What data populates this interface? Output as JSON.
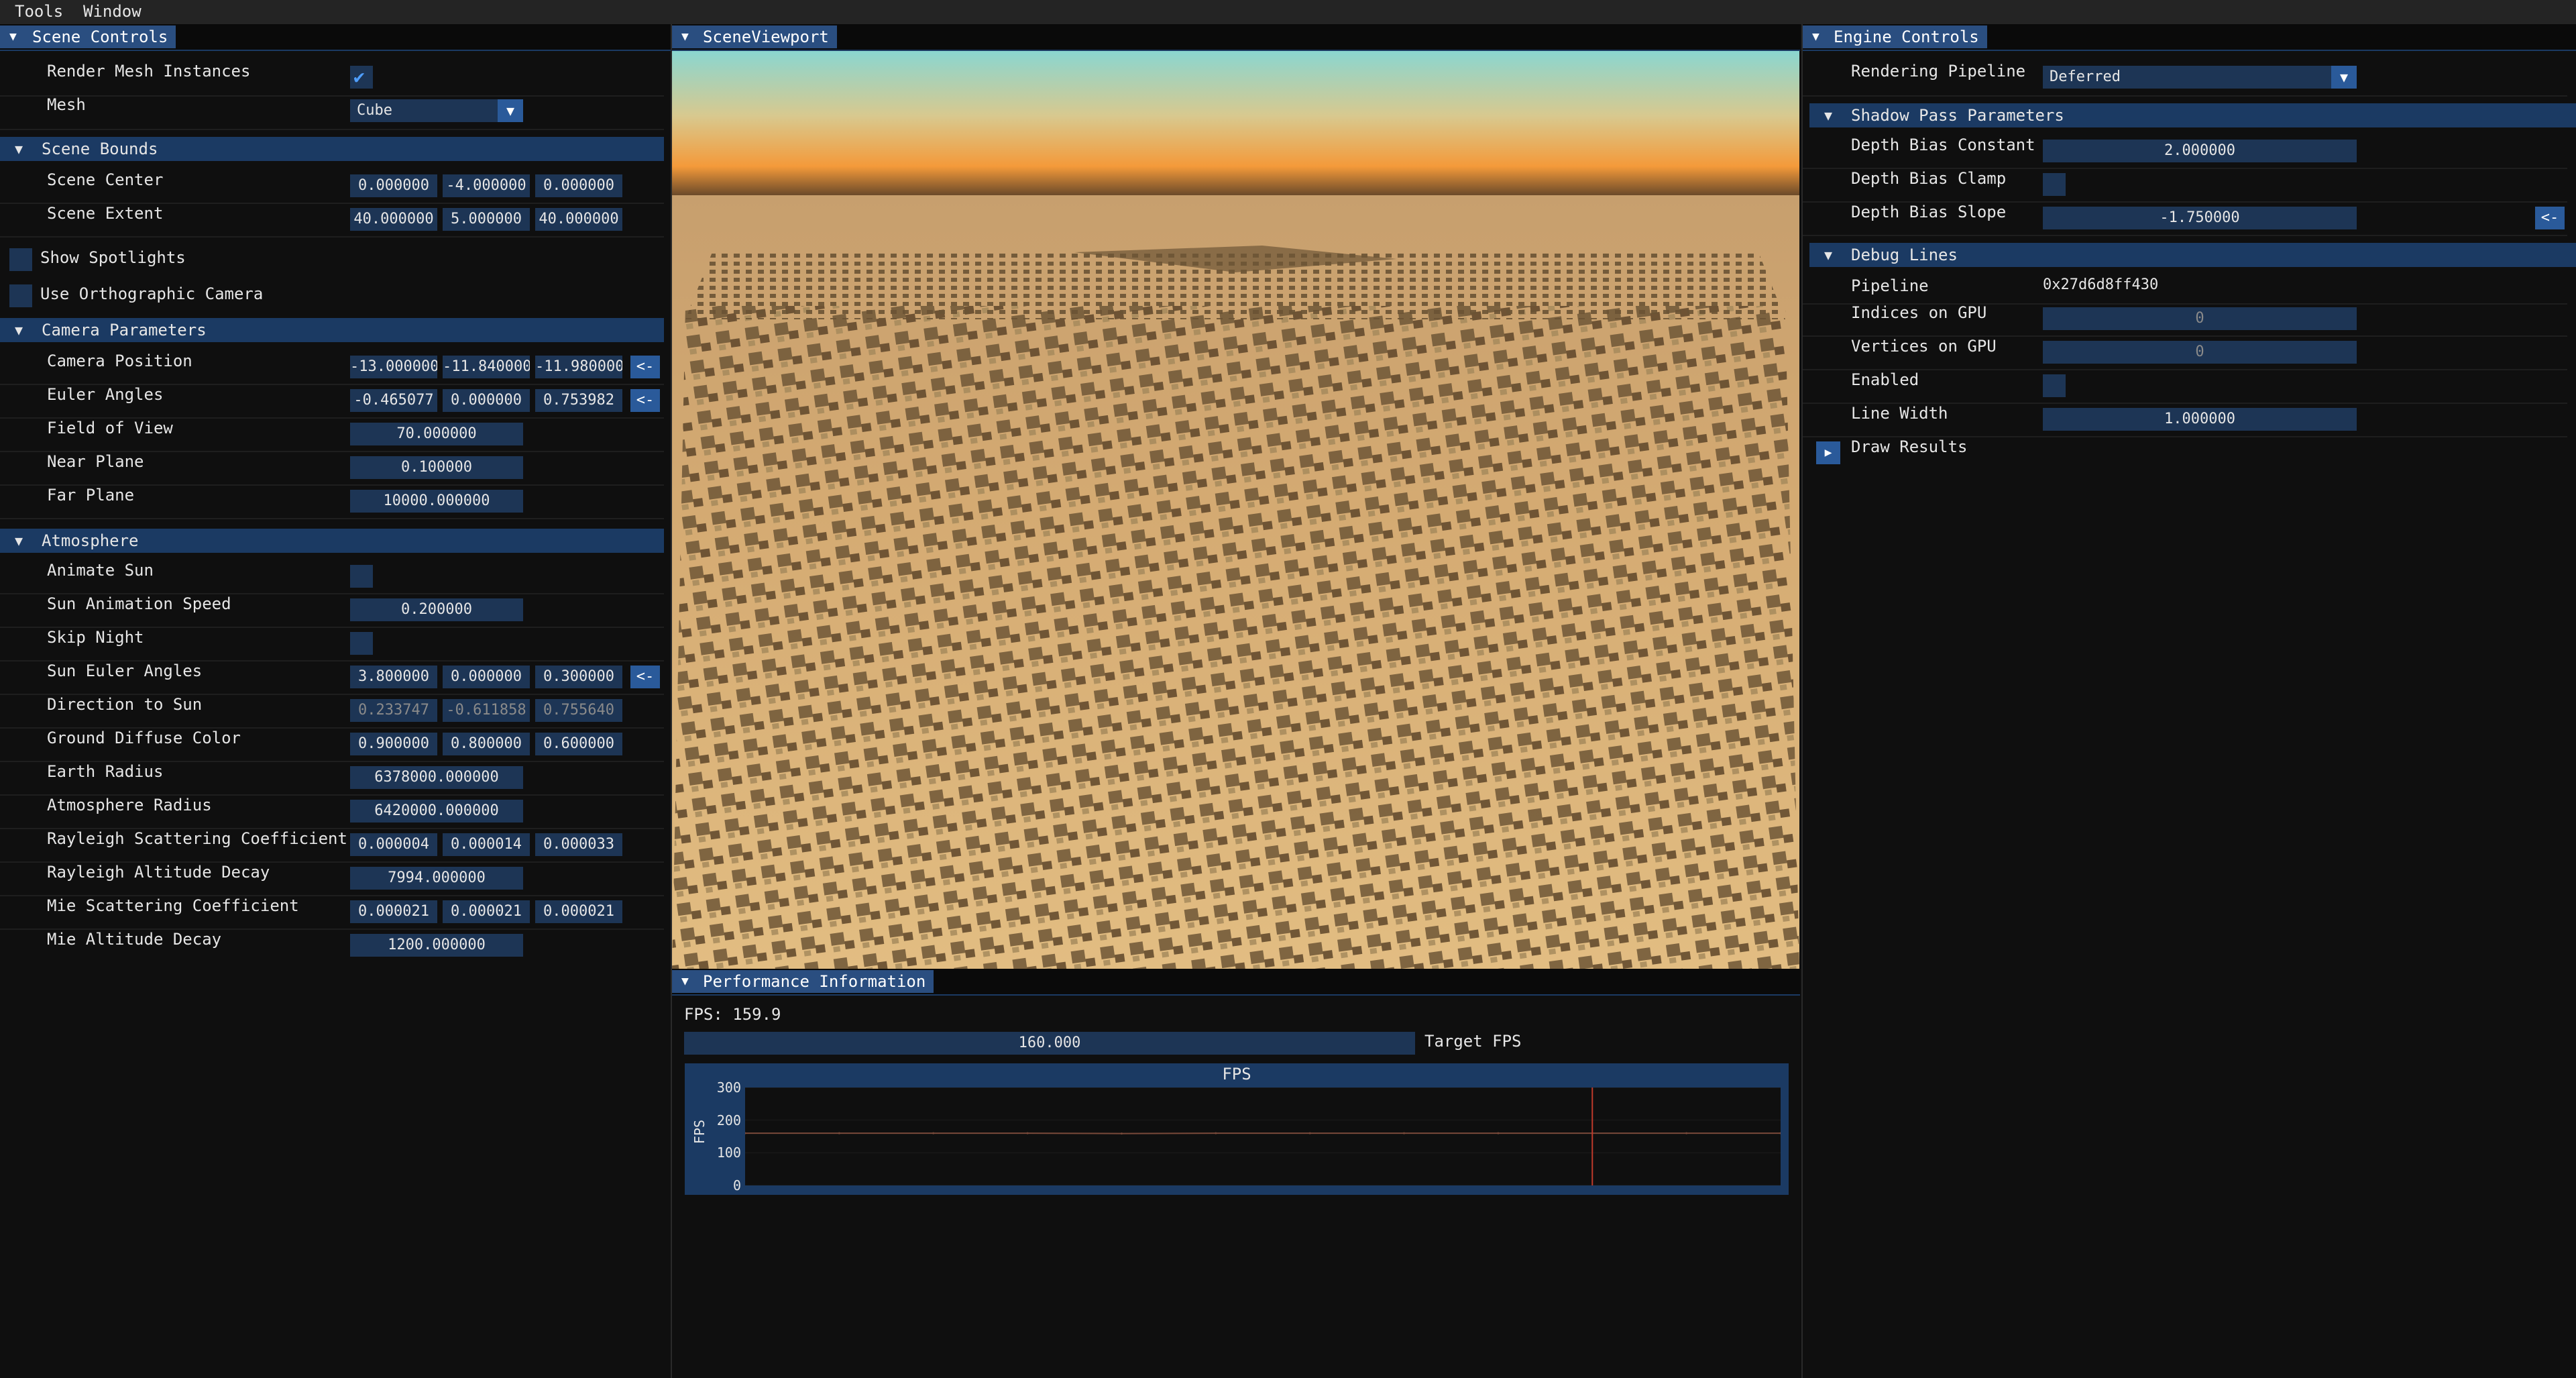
{
  "menubar": {
    "items": [
      "Tools",
      "Window"
    ]
  },
  "scene_controls": {
    "tab": "Scene Controls",
    "render_mesh_instances": {
      "label": "Render Mesh Instances",
      "checked": true
    },
    "mesh": {
      "label": "Mesh",
      "value": "Cube"
    },
    "scene_bounds": {
      "header": "Scene Bounds",
      "center": {
        "label": "Scene Center",
        "values": [
          "0.000000",
          "-4.000000",
          "0.000000"
        ]
      },
      "extent": {
        "label": "Scene Extent",
        "values": [
          "40.000000",
          "5.000000",
          "40.000000"
        ]
      }
    },
    "show_spotlights": {
      "label": "Show Spotlights",
      "checked": false
    },
    "use_ortho": {
      "label": "Use Orthographic Camera",
      "checked": false
    },
    "camera": {
      "header": "Camera Parameters",
      "position": {
        "label": "Camera Position",
        "values": [
          "-13.000000",
          "-11.840000",
          "-11.980000"
        ],
        "button": "<-"
      },
      "euler": {
        "label": "Euler Angles",
        "values": [
          "-0.465077",
          "0.000000",
          "0.753982"
        ],
        "button": "<-"
      },
      "fov": {
        "label": "Field of View",
        "value": "70.000000"
      },
      "near": {
        "label": "Near Plane",
        "value": "0.100000"
      },
      "far": {
        "label": "Far Plane",
        "value": "10000.000000"
      }
    },
    "atmosphere": {
      "header": "Atmosphere",
      "animate_sun": {
        "label": "Animate Sun",
        "checked": false
      },
      "sun_speed": {
        "label": "Sun Animation Speed",
        "value": "0.200000"
      },
      "skip_night": {
        "label": "Skip Night",
        "checked": false
      },
      "sun_euler": {
        "label": "Sun Euler Angles",
        "values": [
          "3.800000",
          "0.000000",
          "0.300000"
        ],
        "button": "<-"
      },
      "dir_to_sun": {
        "label": "Direction to Sun",
        "values": [
          "0.233747",
          "-0.611858",
          "0.755640"
        ]
      },
      "ground_color": {
        "label": "Ground Diffuse Color",
        "values": [
          "0.900000",
          "0.800000",
          "0.600000"
        ]
      },
      "earth_radius": {
        "label": "Earth Radius",
        "value": "6378000.000000"
      },
      "atm_radius": {
        "label": "Atmosphere Radius",
        "value": "6420000.000000"
      },
      "rayleigh_coef": {
        "label": "Rayleigh Scattering Coefficient",
        "values": [
          "0.000004",
          "0.000014",
          "0.000033"
        ]
      },
      "rayleigh_decay": {
        "label": "Rayleigh Altitude Decay",
        "value": "7994.000000"
      },
      "mie_coef": {
        "label": "Mie Scattering Coefficient",
        "values": [
          "0.000021",
          "0.000021",
          "0.000021"
        ]
      },
      "mie_decay": {
        "label": "Mie Altitude Decay",
        "value": "1200.000000"
      }
    }
  },
  "viewport": {
    "tab": "SceneViewport"
  },
  "performance": {
    "tab": "Performance Information",
    "fps_text": "FPS: 159.9",
    "target_value": "160.000",
    "target_label": "Target FPS",
    "graph_title": "FPS"
  },
  "engine_controls": {
    "tab": "Engine Controls",
    "pipeline": {
      "label": "Rendering Pipeline",
      "value": "Deferred"
    },
    "shadow": {
      "header": "Shadow Pass Parameters",
      "bias_const": {
        "label": "Depth Bias Constant",
        "value": "2.000000"
      },
      "bias_clamp": {
        "label": "Depth Bias Clamp",
        "checked": false
      },
      "bias_slope": {
        "label": "Depth Bias Slope",
        "value": "-1.750000",
        "button": "<-"
      }
    },
    "debug": {
      "header": "Debug Lines",
      "pipeline": {
        "label": "Pipeline",
        "value": "0x27d6d8ff430"
      },
      "indices": {
        "label": "Indices on GPU",
        "value": "0"
      },
      "vertices": {
        "label": "Vertices on GPU",
        "value": "0"
      },
      "enabled": {
        "label": "Enabled",
        "checked": false
      },
      "line_width": {
        "label": "Line Width",
        "value": "1.000000"
      }
    },
    "draw_results": {
      "label": "Draw Results"
    }
  },
  "chart_data": {
    "type": "line",
    "title": "FPS",
    "ylabel": "FPS",
    "xlabel": "",
    "ylim": [
      0,
      300
    ],
    "yticks": [
      0,
      100,
      200,
      300
    ],
    "series": [
      {
        "values": [
          160,
          160,
          160,
          160,
          159,
          160,
          160,
          160,
          160,
          159.9,
          160,
          160
        ]
      }
    ],
    "marker_index": 9,
    "colors": {
      "line": "#7a4a3a",
      "marker": "#c0392b"
    }
  },
  "colors": {
    "tab_active": "#2a4e80",
    "header": "#1b3a63",
    "field": "#1d3555",
    "checkmark": "#4f9fff"
  }
}
